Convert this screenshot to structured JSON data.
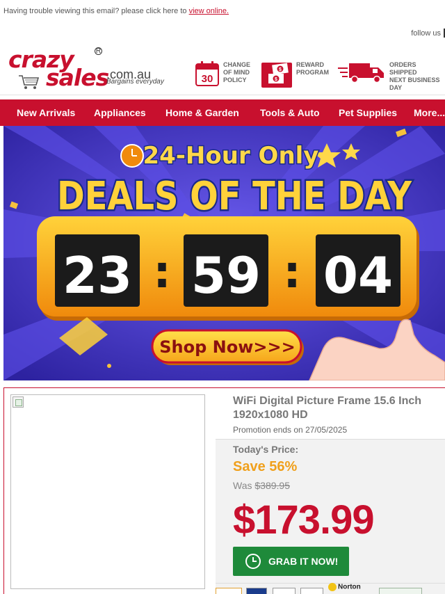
{
  "topbar": {
    "notice": "Having trouble viewing this email? please click here to",
    "view_link": "view online."
  },
  "follow": {
    "label": "follow us"
  },
  "logo": {
    "word1": "crazy",
    "word2": "sales",
    "registered": "R",
    "domain": ".com.au",
    "tagline": "Bargains everyday"
  },
  "features": [
    {
      "icon": "calendar-30-icon",
      "badge": "30",
      "lines": [
        "CHANGE",
        "OF MIND",
        "POLICY"
      ]
    },
    {
      "icon": "dollar-gift-icon",
      "lines": [
        "REWARD",
        "PROGRAM"
      ]
    },
    {
      "icon": "delivery-truck-icon",
      "lines": [
        "ORDERS SHIPPED",
        "NEXT BUSINESS",
        "DAY"
      ]
    }
  ],
  "nav": [
    "New Arrivals",
    "Appliances",
    "Home & Garden",
    "Tools & Auto",
    "Pet Supplies",
    "More..."
  ],
  "banner": {
    "headline_top": "24-Hour Only",
    "headline_main": "DEALS OF THE DAY",
    "countdown": {
      "hours": "23",
      "minutes": "59",
      "seconds": "04",
      "separator": ":"
    },
    "cta": "Shop Now>>>"
  },
  "product": {
    "title": "WiFi Digital Picture Frame 15.6 Inch 1920x1080 HD",
    "promo_end": "Promotion ends on 27/05/2025",
    "price_label": "Today's Price:",
    "save": "Save 56%",
    "was_label": "Was",
    "was_price": "$389.95",
    "price": "$173.99",
    "cta": "GRAB IT NOW!",
    "norton": "Norton"
  },
  "colors": {
    "brand_red": "#c8102e",
    "save_orange": "#f0a01c",
    "cta_green": "#1e8a3a",
    "banner_purple": "#3a2fb0",
    "banner_yellow": "#f6b81c"
  }
}
